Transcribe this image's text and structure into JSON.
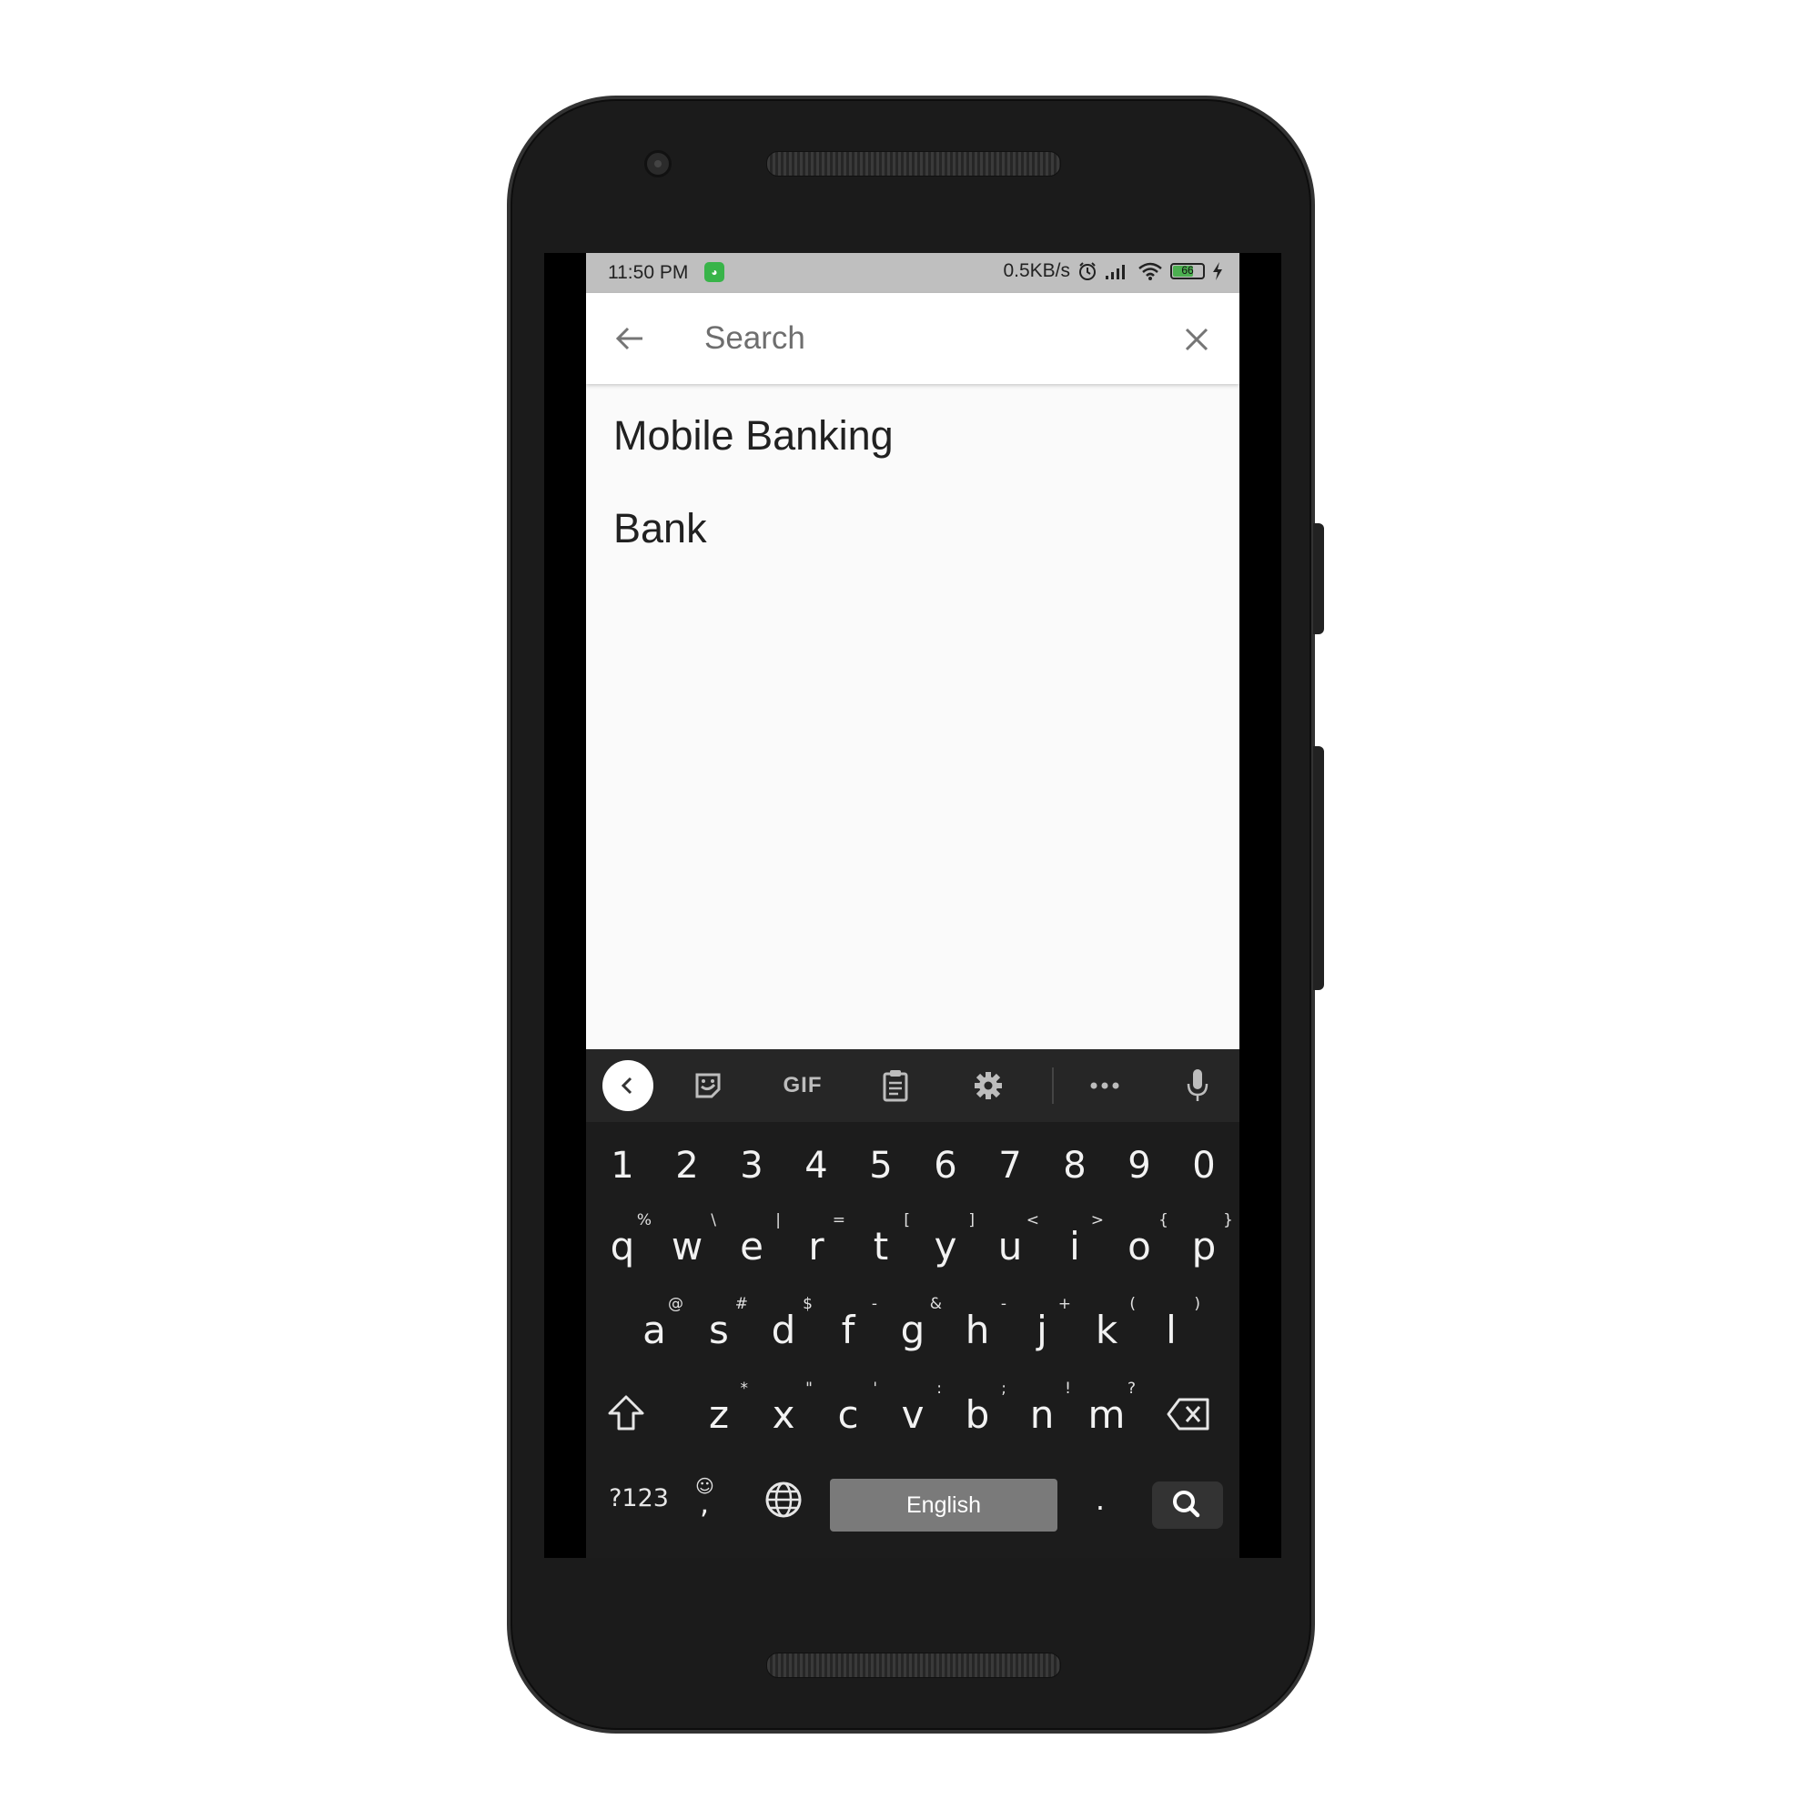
{
  "status_bar": {
    "time": "11:50 PM",
    "net_speed": "0.5KB/s",
    "battery_level": "66",
    "icons": [
      "app-notification-icon",
      "alarm-icon",
      "signal-icon",
      "wifi-icon",
      "battery-icon",
      "charging-icon"
    ]
  },
  "search": {
    "placeholder": "Search",
    "back_icon": "arrow-back-icon",
    "clear_icon": "close-icon"
  },
  "results": [
    {
      "label": "Mobile Banking"
    },
    {
      "label": "Bank"
    }
  ],
  "keyboard": {
    "toolbar_icons": [
      "chevron-left-icon",
      "sticker-icon",
      "gif",
      "clipboard-icon",
      "gear-icon",
      "more-icon",
      "microphone-icon"
    ],
    "gif_label": "GIF",
    "number_row": [
      "1",
      "2",
      "3",
      "4",
      "5",
      "6",
      "7",
      "8",
      "9",
      "0"
    ],
    "row1": [
      {
        "k": "q",
        "h": "%"
      },
      {
        "k": "w",
        "h": "\\"
      },
      {
        "k": "e",
        "h": "|"
      },
      {
        "k": "r",
        "h": "="
      },
      {
        "k": "t",
        "h": "["
      },
      {
        "k": "y",
        "h": "]"
      },
      {
        "k": "u",
        "h": "<"
      },
      {
        "k": "i",
        "h": ">"
      },
      {
        "k": "o",
        "h": "{"
      },
      {
        "k": "p",
        "h": "}"
      }
    ],
    "row2": [
      {
        "k": "a",
        "h": "@"
      },
      {
        "k": "s",
        "h": "#"
      },
      {
        "k": "d",
        "h": "$"
      },
      {
        "k": "f",
        "h": "-"
      },
      {
        "k": "g",
        "h": "&"
      },
      {
        "k": "h",
        "h": "-"
      },
      {
        "k": "j",
        "h": "+"
      },
      {
        "k": "k",
        "h": "("
      },
      {
        "k": "l",
        "h": ")"
      }
    ],
    "row3": [
      {
        "k": "z",
        "h": "*"
      },
      {
        "k": "x",
        "h": "\""
      },
      {
        "k": "c",
        "h": "'"
      },
      {
        "k": "v",
        "h": ":"
      },
      {
        "k": "b",
        "h": ";"
      },
      {
        "k": "n",
        "h": "!"
      },
      {
        "k": "m",
        "h": "?"
      }
    ],
    "symbols_label": "?123",
    "comma_label": ",",
    "space_label": "English",
    "period_label": ".",
    "accent_color": "#7a7a7a"
  }
}
